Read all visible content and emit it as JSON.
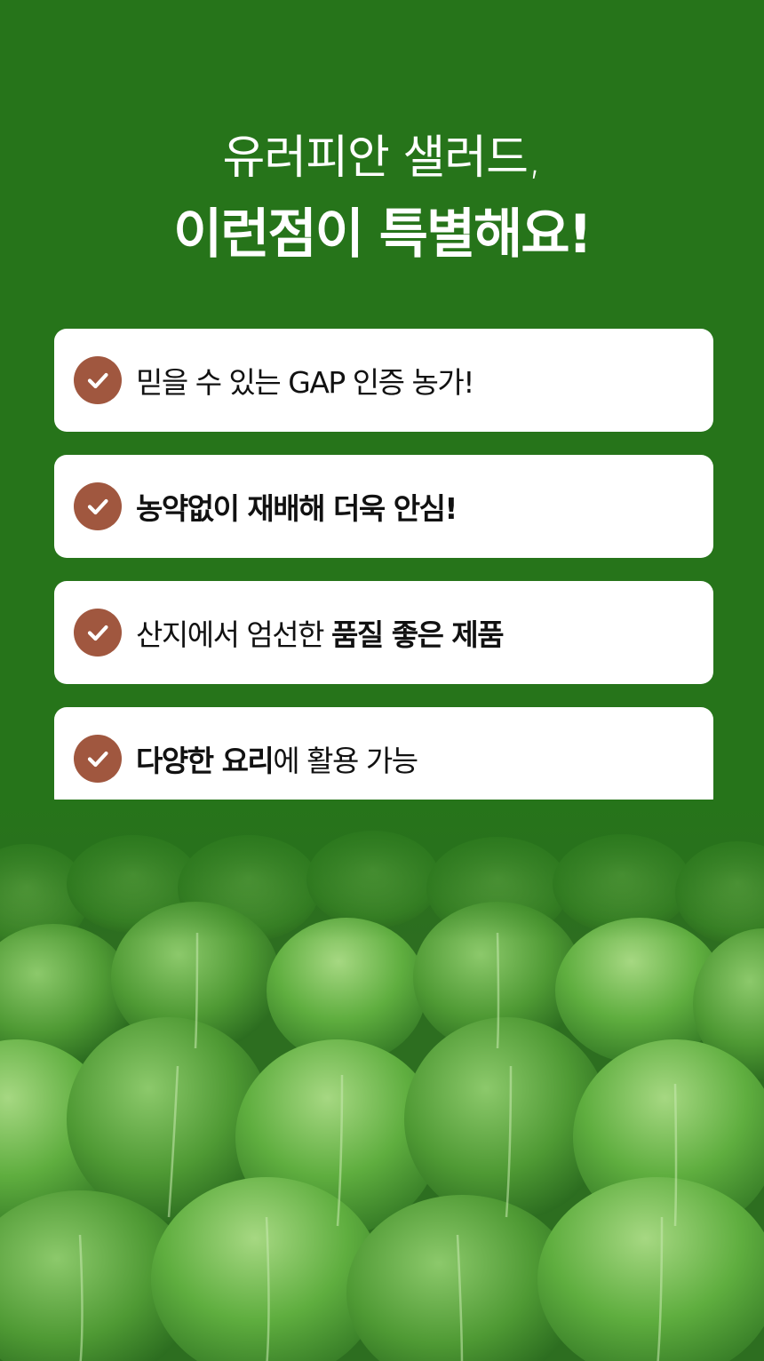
{
  "headline": {
    "line1": "유러피안 샐러드,",
    "line2": "이런점이 특별해요!"
  },
  "features": [
    {
      "parts": [
        {
          "text": "믿을 수 있는 GAP 인증 농가!",
          "bold": false
        }
      ]
    },
    {
      "parts": [
        {
          "text": "농약없이 재배해 더욱 안심!",
          "bold": true
        }
      ]
    },
    {
      "parts": [
        {
          "text": "산지에서 엄선한 ",
          "bold": false
        },
        {
          "text": "품질 좋은 제품",
          "bold": true
        }
      ]
    },
    {
      "parts": [
        {
          "text": "다양한 요리",
          "bold": true
        },
        {
          "text": "에 활용 가능",
          "bold": false
        }
      ]
    }
  ],
  "colors": {
    "background": "#26741a",
    "card": "#ffffff",
    "check_circle": "#a0573f"
  },
  "icons": {
    "feature_bullet": "check-circle-icon"
  },
  "image": {
    "subject": "lettuce-field-photo"
  }
}
